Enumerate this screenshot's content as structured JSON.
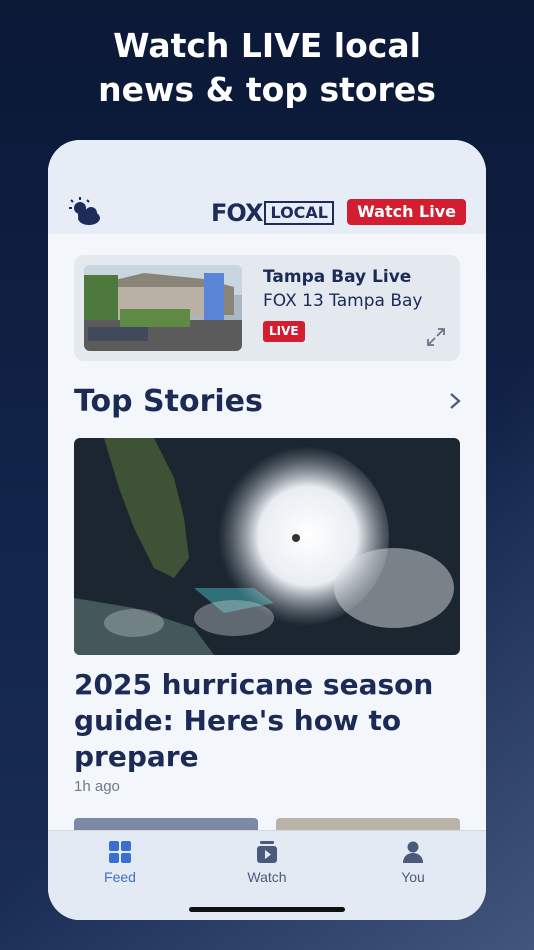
{
  "marketing": {
    "headline_line1": "Watch LIVE local",
    "headline_line2": "news & top stores"
  },
  "header": {
    "brand_fox": "FOX",
    "brand_local": "LOCAL",
    "watch_live_label": "Watch Live",
    "weather_icon": "partly-cloudy-icon"
  },
  "live_card": {
    "title": "Tampa Bay Live",
    "subtitle": "FOX 13 Tampa Bay",
    "badge": "LIVE",
    "expand_icon": "expand-icon"
  },
  "top_stories": {
    "section_title": "Top Stories",
    "chevron_icon": "chevron-right-icon",
    "lead": {
      "headline": "2025 hurricane season guide: Here's how to prepare",
      "time": "1h ago"
    }
  },
  "tabbar": {
    "tabs": [
      {
        "label": "Feed",
        "icon": "grid-icon",
        "active": true
      },
      {
        "label": "Watch",
        "icon": "play-stack-icon",
        "active": false
      },
      {
        "label": "You",
        "icon": "person-icon",
        "active": false
      }
    ]
  },
  "colors": {
    "accent_red": "#d21e30",
    "brand_navy": "#1c2b55",
    "active_tab": "#3a6fd0"
  }
}
